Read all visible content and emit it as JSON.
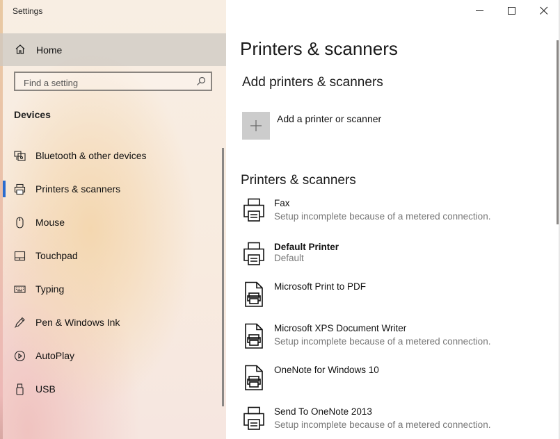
{
  "window": {
    "title": "Settings"
  },
  "nav": {
    "home_label": "Home",
    "search_placeholder": "Find a setting",
    "section_title": "Devices",
    "items": [
      {
        "label": "Bluetooth & other devices",
        "icon": "bluetooth-devices-icon"
      },
      {
        "label": "Printers & scanners",
        "icon": "printer-icon",
        "selected": true
      },
      {
        "label": "Mouse",
        "icon": "mouse-icon"
      },
      {
        "label": "Touchpad",
        "icon": "touchpad-icon"
      },
      {
        "label": "Typing",
        "icon": "keyboard-icon"
      },
      {
        "label": "Pen & Windows Ink",
        "icon": "pen-icon"
      },
      {
        "label": "AutoPlay",
        "icon": "autoplay-icon"
      },
      {
        "label": "USB",
        "icon": "usb-icon"
      }
    ]
  },
  "main": {
    "page_title": "Printers & scanners",
    "add_section_title": "Add printers & scanners",
    "add_button_label": "Add a printer or scanner",
    "list_section_title": "Printers & scanners",
    "printers": [
      {
        "name": "Fax",
        "status": "Setup incomplete because of a metered connection.",
        "icon": "printer-icon"
      },
      {
        "name": "Default Printer",
        "status": "Default",
        "icon": "printer-icon",
        "bold": true
      },
      {
        "name": "Microsoft Print to PDF",
        "status": "",
        "icon": "document-printer-icon"
      },
      {
        "name": "Microsoft XPS Document Writer",
        "status": "Setup incomplete because of a metered connection.",
        "icon": "document-printer-icon"
      },
      {
        "name": "OneNote for Windows 10",
        "status": "",
        "icon": "document-printer-icon"
      },
      {
        "name": "Send To OneNote 2013",
        "status": "Setup incomplete because of a metered connection.",
        "icon": "printer-icon"
      }
    ]
  },
  "colors": {
    "accent": "#2a6ccf",
    "add_tile": "#cccccc",
    "status_text": "#777777"
  }
}
